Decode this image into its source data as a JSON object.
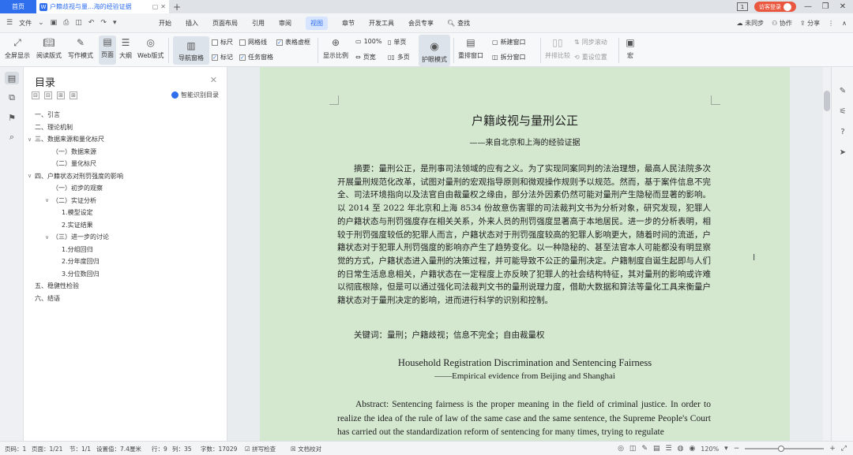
{
  "titlebar": {
    "home_tab": "首页",
    "doc_tab": "户籍歧视与量...海的经验证据",
    "new_tab": "+",
    "page_indicator": "1",
    "visitor_login": "访客登录",
    "min": "—",
    "restore": "❐",
    "close": "✕"
  },
  "menubar": {
    "file": "文件",
    "tabs": [
      "开始",
      "插入",
      "页面布局",
      "引用",
      "审阅",
      "视图",
      "章节",
      "开发工具",
      "会员专享"
    ],
    "active_tab": "视图",
    "search": "查找",
    "right": {
      "sync": "未同步",
      "collab": "协作",
      "share": "分享"
    }
  },
  "toolbar": {
    "full_display": "全屏显示",
    "read_mode": "阅读版式",
    "write_mode": "写作模式",
    "page": "页面",
    "outline": "大纲",
    "web": "Web版式",
    "nav_pane": "导航窗格",
    "ruler": "标尺",
    "gridlines": "网格线",
    "table_border": "表格虚框",
    "mark": "标记",
    "task_pane": "任务窗格",
    "display_ratio": "显示比例",
    "zoom100": "100%",
    "page_width": "页宽",
    "single_page": "单页",
    "multi_page": "多页",
    "eye_mode": "护眼模式",
    "rearrange": "重排窗口",
    "new_window": "新建窗口",
    "split_window": "拆分窗口",
    "side_by_side": "并排比较",
    "sync_scroll": "同步滚动",
    "reset_position": "重设位置",
    "macro": "宏"
  },
  "toc": {
    "title": "目录",
    "smart_toc": "智能识别目录",
    "items": [
      {
        "label": "一、引言",
        "arrow": ""
      },
      {
        "label": "二、理论机制",
        "arrow": ""
      },
      {
        "label": "三、数据来源和量化标尺",
        "arrow": "∨"
      },
      {
        "label": "（一）数据来源",
        "arrow": ""
      },
      {
        "label": "（二）量化标尺",
        "arrow": ""
      },
      {
        "label": "四、户籍状态对刑罚强度的影响",
        "arrow": "∨"
      },
      {
        "label": "（一）初步的观察",
        "arrow": ""
      },
      {
        "label": "（二）实证分析",
        "arrow": "∨"
      },
      {
        "label": "1.模型设定",
        "arrow": ""
      },
      {
        "label": "2.实证结果",
        "arrow": ""
      },
      {
        "label": "（三）进一步的讨论",
        "arrow": "∨"
      },
      {
        "label": "1.分组回归",
        "arrow": ""
      },
      {
        "label": "2.分年度回归",
        "arrow": ""
      },
      {
        "label": "3.分位数回归",
        "arrow": ""
      },
      {
        "label": "五、稳健性检验",
        "arrow": ""
      },
      {
        "label": "六、结语",
        "arrow": ""
      }
    ]
  },
  "document": {
    "title": "户籍歧视与量刑公正",
    "subtitle": "——来自北京和上海的经验证据",
    "abstract": "摘要：量刑公正，是刑事司法领域的应有之义。为了实现同案同判的法治理想，最高人民法院多次开展量刑规范化改革，试图对量刑的宏观指导原则和微观操作规则予以规范。然而，基于案件信息不完全、司法环境指向以及法官自由裁量权之缘由，部分法外因素仍然可能对量刑产生隐秘而显著的影响。以 2014 至 2022 年北京和上海 8534 份故意伤害罪的司法裁判文书为分析对象，研究发现，犯罪人的户籍状态与刑罚强度存在相关关系，外来人员的刑罚强度显著高于本地居民。进一步的分析表明，相较于刑罚强度较低的犯罪人而言，户籍状态对于刑罚强度较高的犯罪人影响更大，随着时间的流逝，户籍状态对于犯罪人刑罚强度的影响亦产生了趋势变化。以一种隐秘的、甚至法官本人可能都没有明显察觉的方式，户籍状态进入量刑的决策过程，并可能导致不公正的量刑决定。户籍制度自诞生起即与人们的日常生活息息相关，户籍状态在一定程度上亦反映了犯罪人的社会结构特征，其对量刑的影响或许难以彻底根除，但是可以通过强化司法裁判文书的量刑说理力度，借助大数据和算法等量化工具来衡量户籍状态对于量刑决定的影响，进而进行科学的识别和控制。",
    "keywords": "关键词：量刑；户籍歧视；信息不完全；自由裁量权",
    "en_title": "Household Registration Discrimination and Sentencing Fairness",
    "en_subtitle": "——Empirical evidence from Beijing and Shanghai",
    "en_abstract": "Abstract: Sentencing fairness is the proper meaning in the field of criminal justice. In order to realize the idea of the rule of law of the same case and the same sentence, the Supreme People's Court has carried out the standardization reform of sentencing for many times, trying to regulate"
  },
  "statusbar": {
    "page_num": "页码：1",
    "page_of": "页面：1/21",
    "section": "节：1/1",
    "setting": "设置值：7.4厘米",
    "row": "行：9",
    "col": "列：35",
    "word_count": "字数：17029",
    "spell_check": "拼写检查",
    "doc_proof": "文档校对",
    "zoom": "120%",
    "zoom_fraction": 0.46
  }
}
